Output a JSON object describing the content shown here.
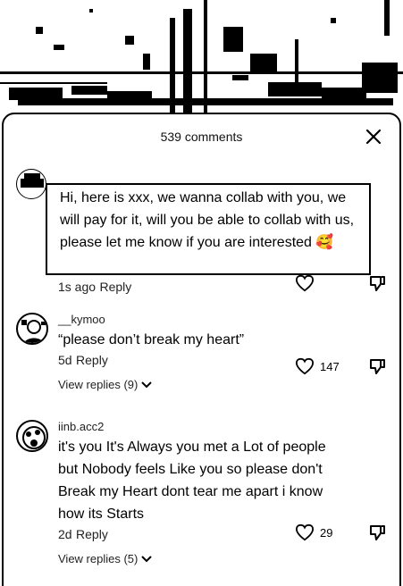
{
  "sheet": {
    "title": "539 comments"
  },
  "comments": [
    {
      "username": "",
      "text": "Hi, here is xxx, we wanna collab with you, we will pay for it, will you be able to collab with us, please let me know if you are interested 🥰",
      "time": "1s ago",
      "reply": "Reply",
      "likes": "",
      "view_replies": ""
    },
    {
      "username": "__kymoo",
      "text": "“please don’t break my heart”",
      "time": "5d",
      "reply": "Reply",
      "likes": "147",
      "view_replies": "View replies (9)"
    },
    {
      "username": "iinb.acc2",
      "text": "it's you It's Always you met a Lot of people but Nobody feels Like you so please don't Break my Heart dont tear me apart i know how its Starts",
      "time": "2d",
      "reply": "Reply",
      "likes": "29",
      "view_replies": "View replies (5)"
    }
  ],
  "icons": {
    "close": "close-icon",
    "like": "heart-icon",
    "dislike": "thumbs-down-icon",
    "expand": "chevron-down-icon"
  }
}
